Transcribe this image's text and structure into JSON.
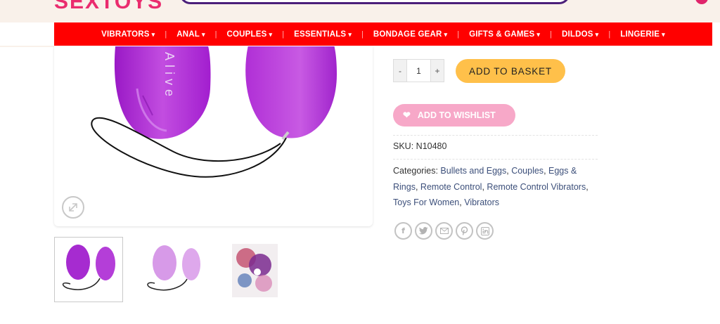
{
  "header": {
    "logo_text": "SEXTOYS",
    "brand_color": "#ea2c6e",
    "search_border_color": "#4b1f7a"
  },
  "nav": {
    "background": "#ff0000",
    "items": [
      {
        "label": "VIBRATORS"
      },
      {
        "label": "ANAL"
      },
      {
        "label": "COUPLES"
      },
      {
        "label": "ESSENTIALS"
      },
      {
        "label": "BONDAGE GEAR"
      },
      {
        "label": "GIFTS & GAMES"
      },
      {
        "label": "DILDOS"
      },
      {
        "label": "LINGERIE"
      }
    ],
    "chevron_icon": "chevron-down-icon"
  },
  "product": {
    "image_alt": "Alive purple remote control egg",
    "egg_text": "Alive",
    "quantity": "1",
    "qty_minus": "-",
    "qty_plus": "+",
    "add_to_basket": "ADD TO BASKET",
    "add_to_wishlist": "ADD TO WISHLIST",
    "sku_label": "SKU:",
    "sku_value": "N10480",
    "categories_label": "Categories:",
    "categories": [
      "Bullets and Eggs",
      "Couples",
      "Eggs & Rings",
      "Remote Control",
      "Remote Control Vibrators",
      "Toys For Women",
      "Vibrators"
    ],
    "accent_button": "#ffc04a",
    "wishlist_color": "#f7a8c8"
  },
  "share": {
    "icons": [
      "facebook-icon",
      "twitter-icon",
      "email-icon",
      "pinterest-icon",
      "linkedin-icon"
    ]
  }
}
